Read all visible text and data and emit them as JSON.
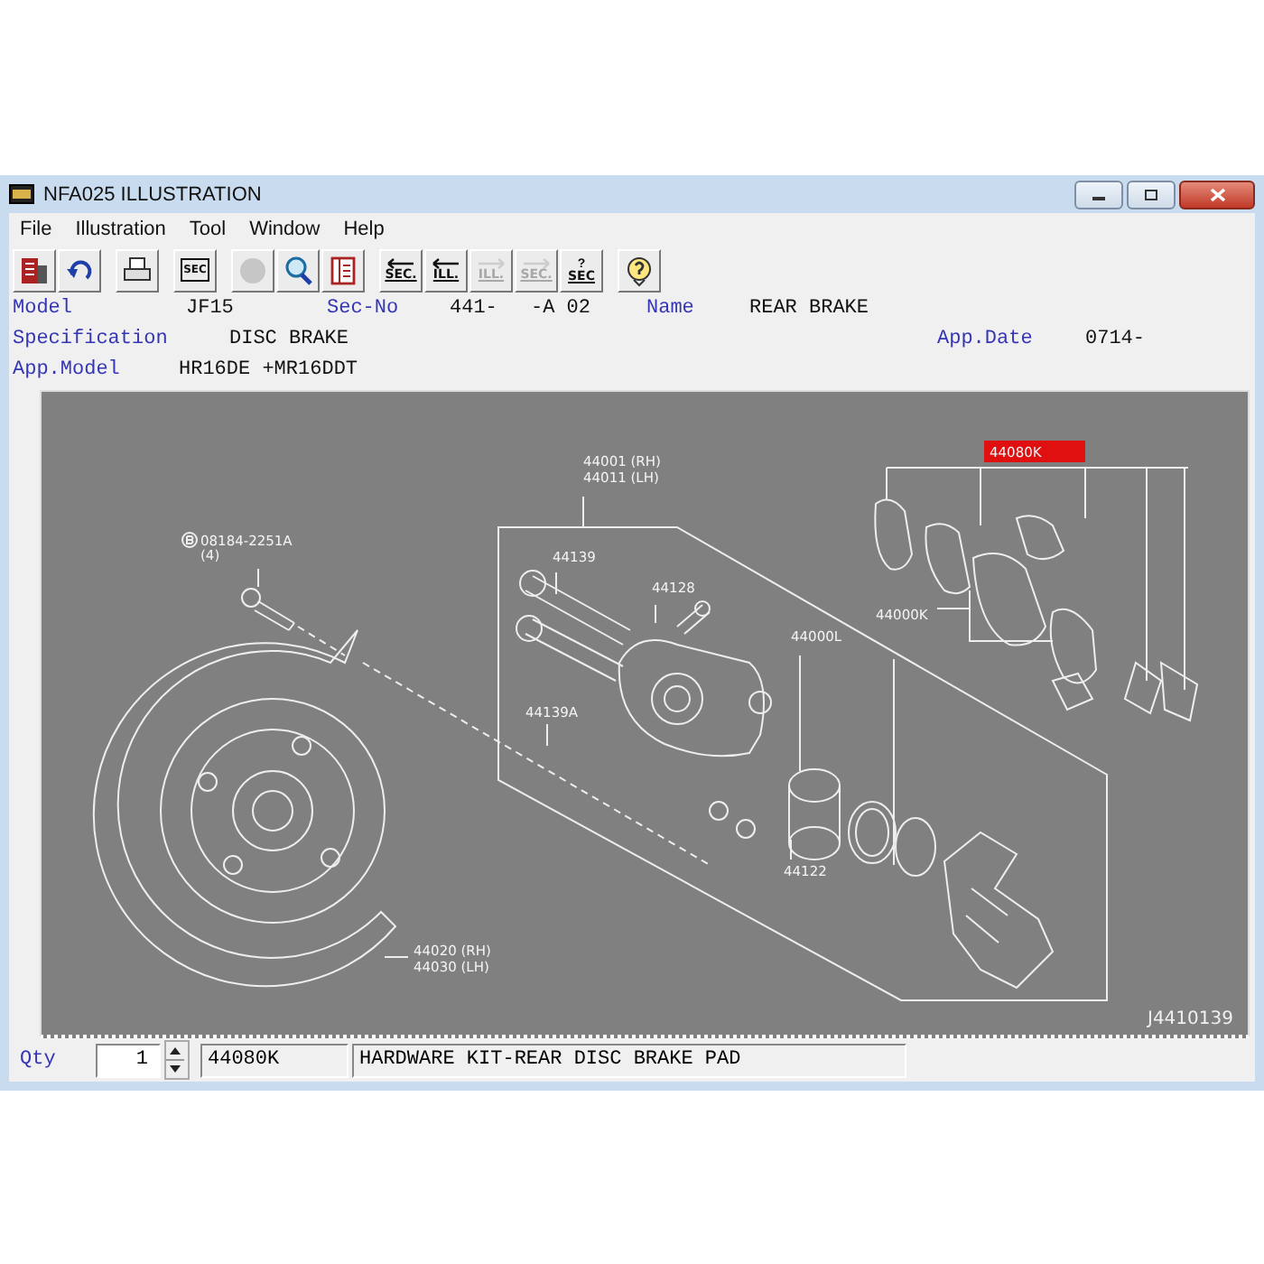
{
  "window": {
    "title": "NFA025 ILLUSTRATION"
  },
  "menu": [
    "File",
    "Illustration",
    "Tool",
    "Window",
    "Help"
  ],
  "toolbar": {
    "groups": [
      {
        "buttons": [
          {
            "kind": "exit",
            "disabled": false
          },
          {
            "kind": "undo",
            "disabled": false
          }
        ]
      },
      {
        "buttons": [
          {
            "kind": "print",
            "disabled": false
          }
        ]
      },
      {
        "buttons": [
          {
            "kind": "sec-box",
            "label": "SEC",
            "disabled": false
          }
        ]
      },
      {
        "buttons": [
          {
            "kind": "circle",
            "disabled": true
          },
          {
            "kind": "search",
            "disabled": false
          },
          {
            "kind": "book",
            "disabled": false
          }
        ]
      },
      {
        "buttons": [
          {
            "kind": "back",
            "label": "SEC.",
            "disabled": false
          },
          {
            "kind": "back",
            "label": "ILL.",
            "disabled": false
          },
          {
            "kind": "next",
            "label": "ILL.",
            "disabled": true
          },
          {
            "kind": "next",
            "label": "SEC.",
            "disabled": true
          },
          {
            "kind": "query",
            "label": "SEC",
            "top": "?",
            "disabled": false
          }
        ]
      },
      {
        "buttons": [
          {
            "kind": "help",
            "disabled": false
          }
        ]
      }
    ]
  },
  "info": {
    "model_label": "Model",
    "model": "JF15",
    "sec_no_label": "Sec-No",
    "sec_no": "441-",
    "sec_no_suffix": "-A 02",
    "name_label": "Name",
    "name": "REAR BRAKE",
    "specification_label": "Specification",
    "specification": "DISC BRAKE",
    "app_date_label": "App.Date",
    "app_date": "0714-",
    "app_model_label": "App.Model",
    "app_model": "HR16DE +MR16DDT"
  },
  "diagram": {
    "reference": "J4410139",
    "callouts": [
      {
        "text": "44001 (RH)",
        "selected": false
      },
      {
        "text": "44011 (LH)",
        "selected": false
      },
      {
        "text": "44080K",
        "selected": true
      },
      {
        "text": "44139",
        "selected": false
      },
      {
        "text": "44128",
        "selected": false
      },
      {
        "text": "44000L",
        "selected": false
      },
      {
        "text": "44000K",
        "selected": false
      },
      {
        "text": "08184-2251A",
        "selected": false
      },
      {
        "text": "(4)",
        "selected": false
      },
      {
        "text": "44139A",
        "selected": false
      },
      {
        "text": "44122",
        "selected": false
      },
      {
        "text": "44020 (RH)",
        "selected": false
      },
      {
        "text": "44030 (LH)",
        "selected": false
      }
    ]
  },
  "footer": {
    "qty_label": "Qty",
    "qty": "1",
    "part_number": "44080K",
    "description": "HARDWARE KIT-REAR DISC BRAKE PAD"
  }
}
